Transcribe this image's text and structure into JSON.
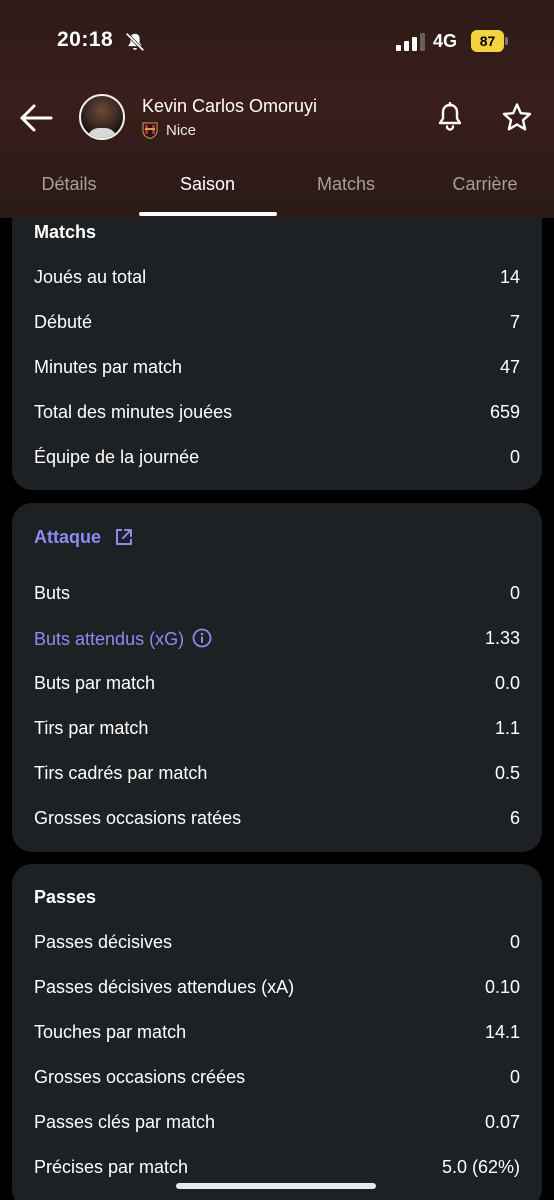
{
  "status_bar": {
    "time": "20:18",
    "network": "4G",
    "battery": "87"
  },
  "player": {
    "name": "Kevin Carlos Omoruyi",
    "club": "Nice"
  },
  "tabs": [
    {
      "label": "Détails"
    },
    {
      "label": "Saison"
    },
    {
      "label": "Matchs"
    },
    {
      "label": "Carrière"
    }
  ],
  "active_tab": "Saison",
  "sections": {
    "matchs": {
      "title": "Matchs",
      "rows": [
        {
          "label": "Joués au total",
          "value": "14"
        },
        {
          "label": "Débuté",
          "value": "7"
        },
        {
          "label": "Minutes par match",
          "value": "47"
        },
        {
          "label": "Total des minutes jouées",
          "value": "659"
        },
        {
          "label": "Équipe de la journée",
          "value": "0"
        }
      ]
    },
    "attaque": {
      "title": "Attaque",
      "rows": [
        {
          "label": "Buts",
          "value": "0"
        },
        {
          "label": "Buts attendus (xG)",
          "value": "1.33"
        },
        {
          "label": "Buts par match",
          "value": "0.0"
        },
        {
          "label": "Tirs par match",
          "value": "1.1"
        },
        {
          "label": "Tirs cadrés par match",
          "value": "0.5"
        },
        {
          "label": "Grosses occasions ratées",
          "value": "6"
        }
      ]
    },
    "passes": {
      "title": "Passes",
      "rows": [
        {
          "label": "Passes décisives",
          "value": "0"
        },
        {
          "label": "Passes décisives attendues (xA)",
          "value": "0.10"
        },
        {
          "label": "Touches par match",
          "value": "14.1"
        },
        {
          "label": "Grosses occasions créées",
          "value": "0"
        },
        {
          "label": "Passes clés par match",
          "value": "0.07"
        },
        {
          "label": "Précises par match",
          "value": "5.0 (62%)"
        }
      ]
    }
  },
  "colors": {
    "card_bg": "#1d2124",
    "link": "#8b8cf2",
    "header_bg": "#3a1e1b",
    "battery": "#f5d33e"
  }
}
